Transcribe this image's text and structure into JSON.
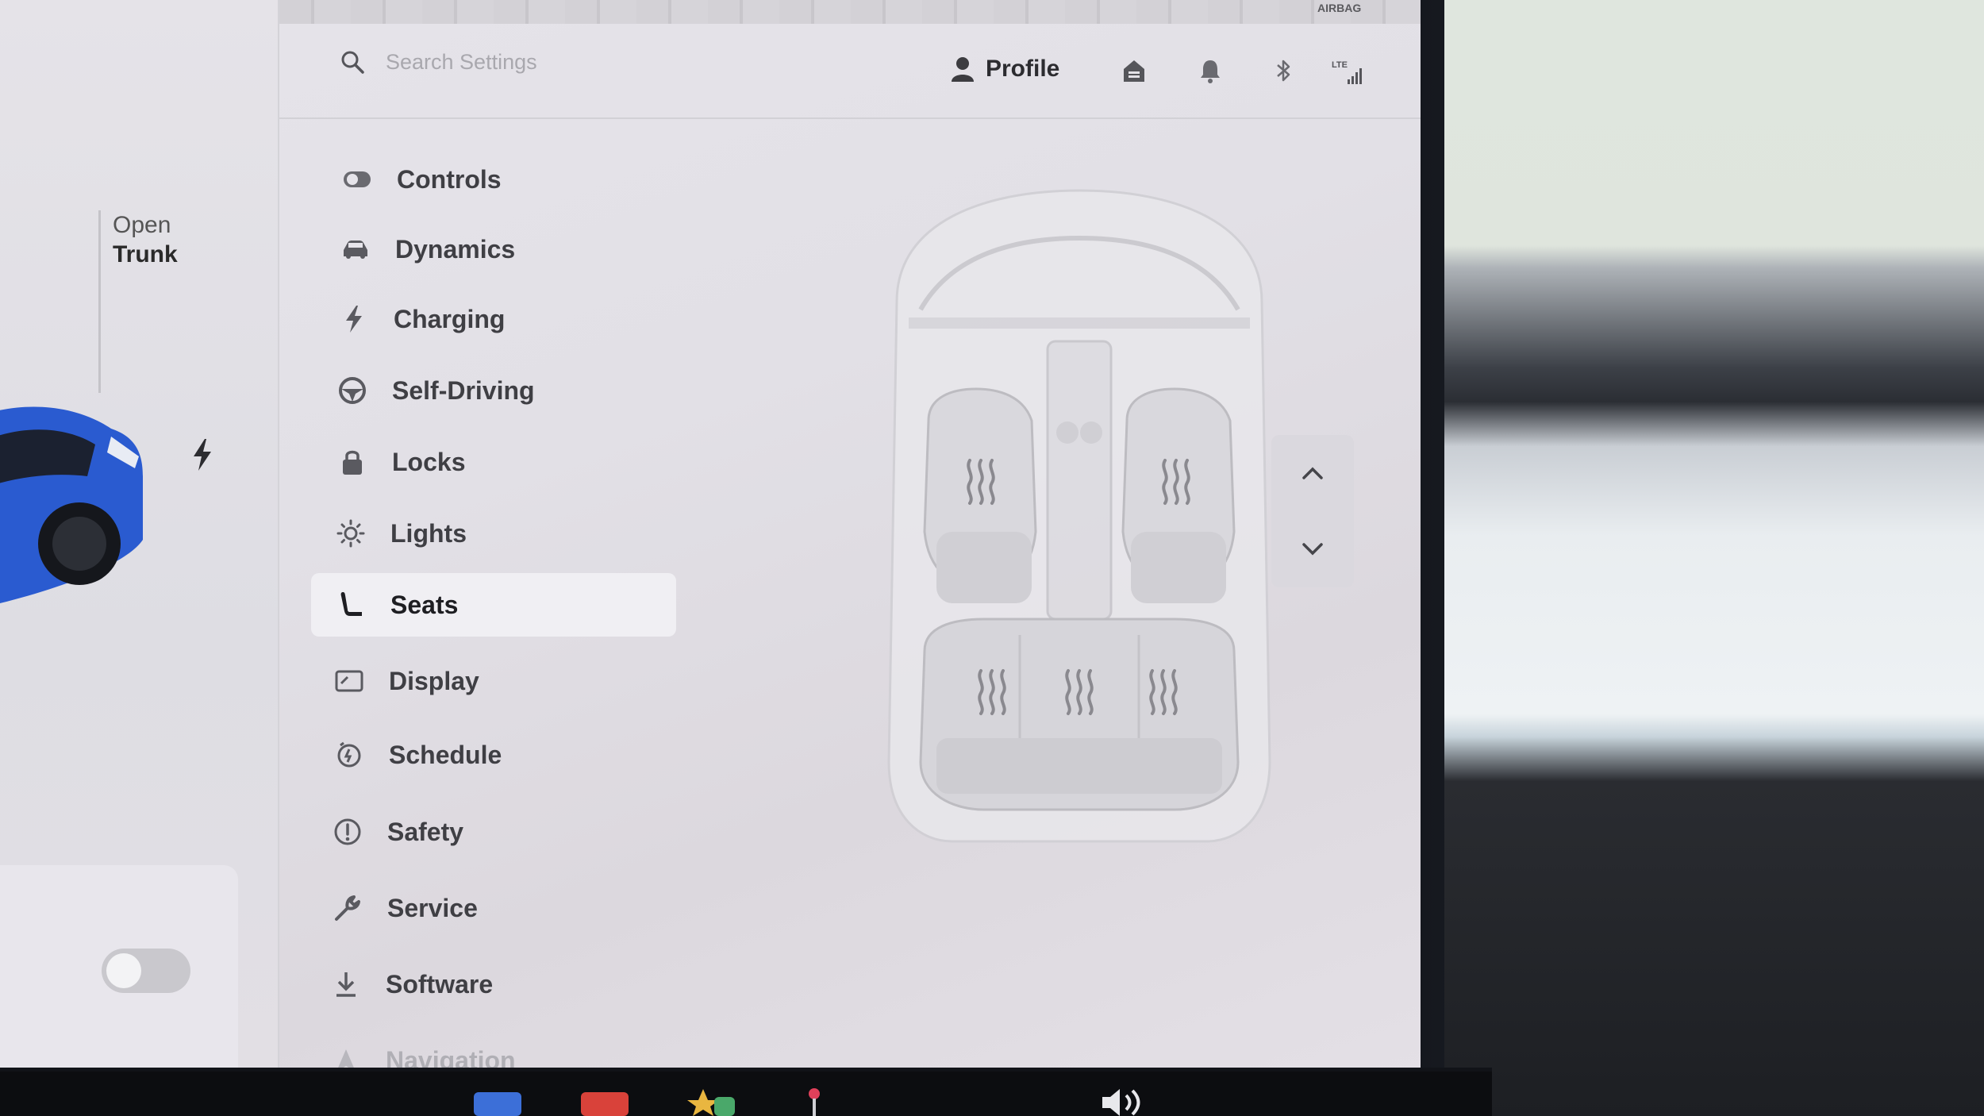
{
  "status": {
    "airbag_text": "AIRBAG"
  },
  "car_panel": {
    "trunk_line1": "Open",
    "trunk_line2": "Trunk"
  },
  "search": {
    "placeholder": "Search Settings"
  },
  "topbar": {
    "profile_label": "Profile",
    "signal_label": "LTE"
  },
  "menu": {
    "items": [
      {
        "label": "Controls",
        "icon": "toggle-icon"
      },
      {
        "label": "Dynamics",
        "icon": "car-icon"
      },
      {
        "label": "Charging",
        "icon": "bolt-icon"
      },
      {
        "label": "Self-Driving",
        "icon": "steering-wheel-icon"
      },
      {
        "label": "Locks",
        "icon": "lock-icon"
      },
      {
        "label": "Lights",
        "icon": "sun-icon"
      },
      {
        "label": "Seats",
        "icon": "seat-icon",
        "selected": true
      },
      {
        "label": "Display",
        "icon": "display-icon"
      },
      {
        "label": "Schedule",
        "icon": "schedule-icon"
      },
      {
        "label": "Safety",
        "icon": "safety-icon"
      },
      {
        "label": "Service",
        "icon": "wrench-icon"
      },
      {
        "label": "Software",
        "icon": "download-icon"
      },
      {
        "label": "Navigation",
        "icon": "navigation-icon"
      }
    ]
  },
  "colors": {
    "accent_car": "#2a5bd0",
    "text_primary": "#3f3f44",
    "screen_bg": "#e4e2e8"
  }
}
